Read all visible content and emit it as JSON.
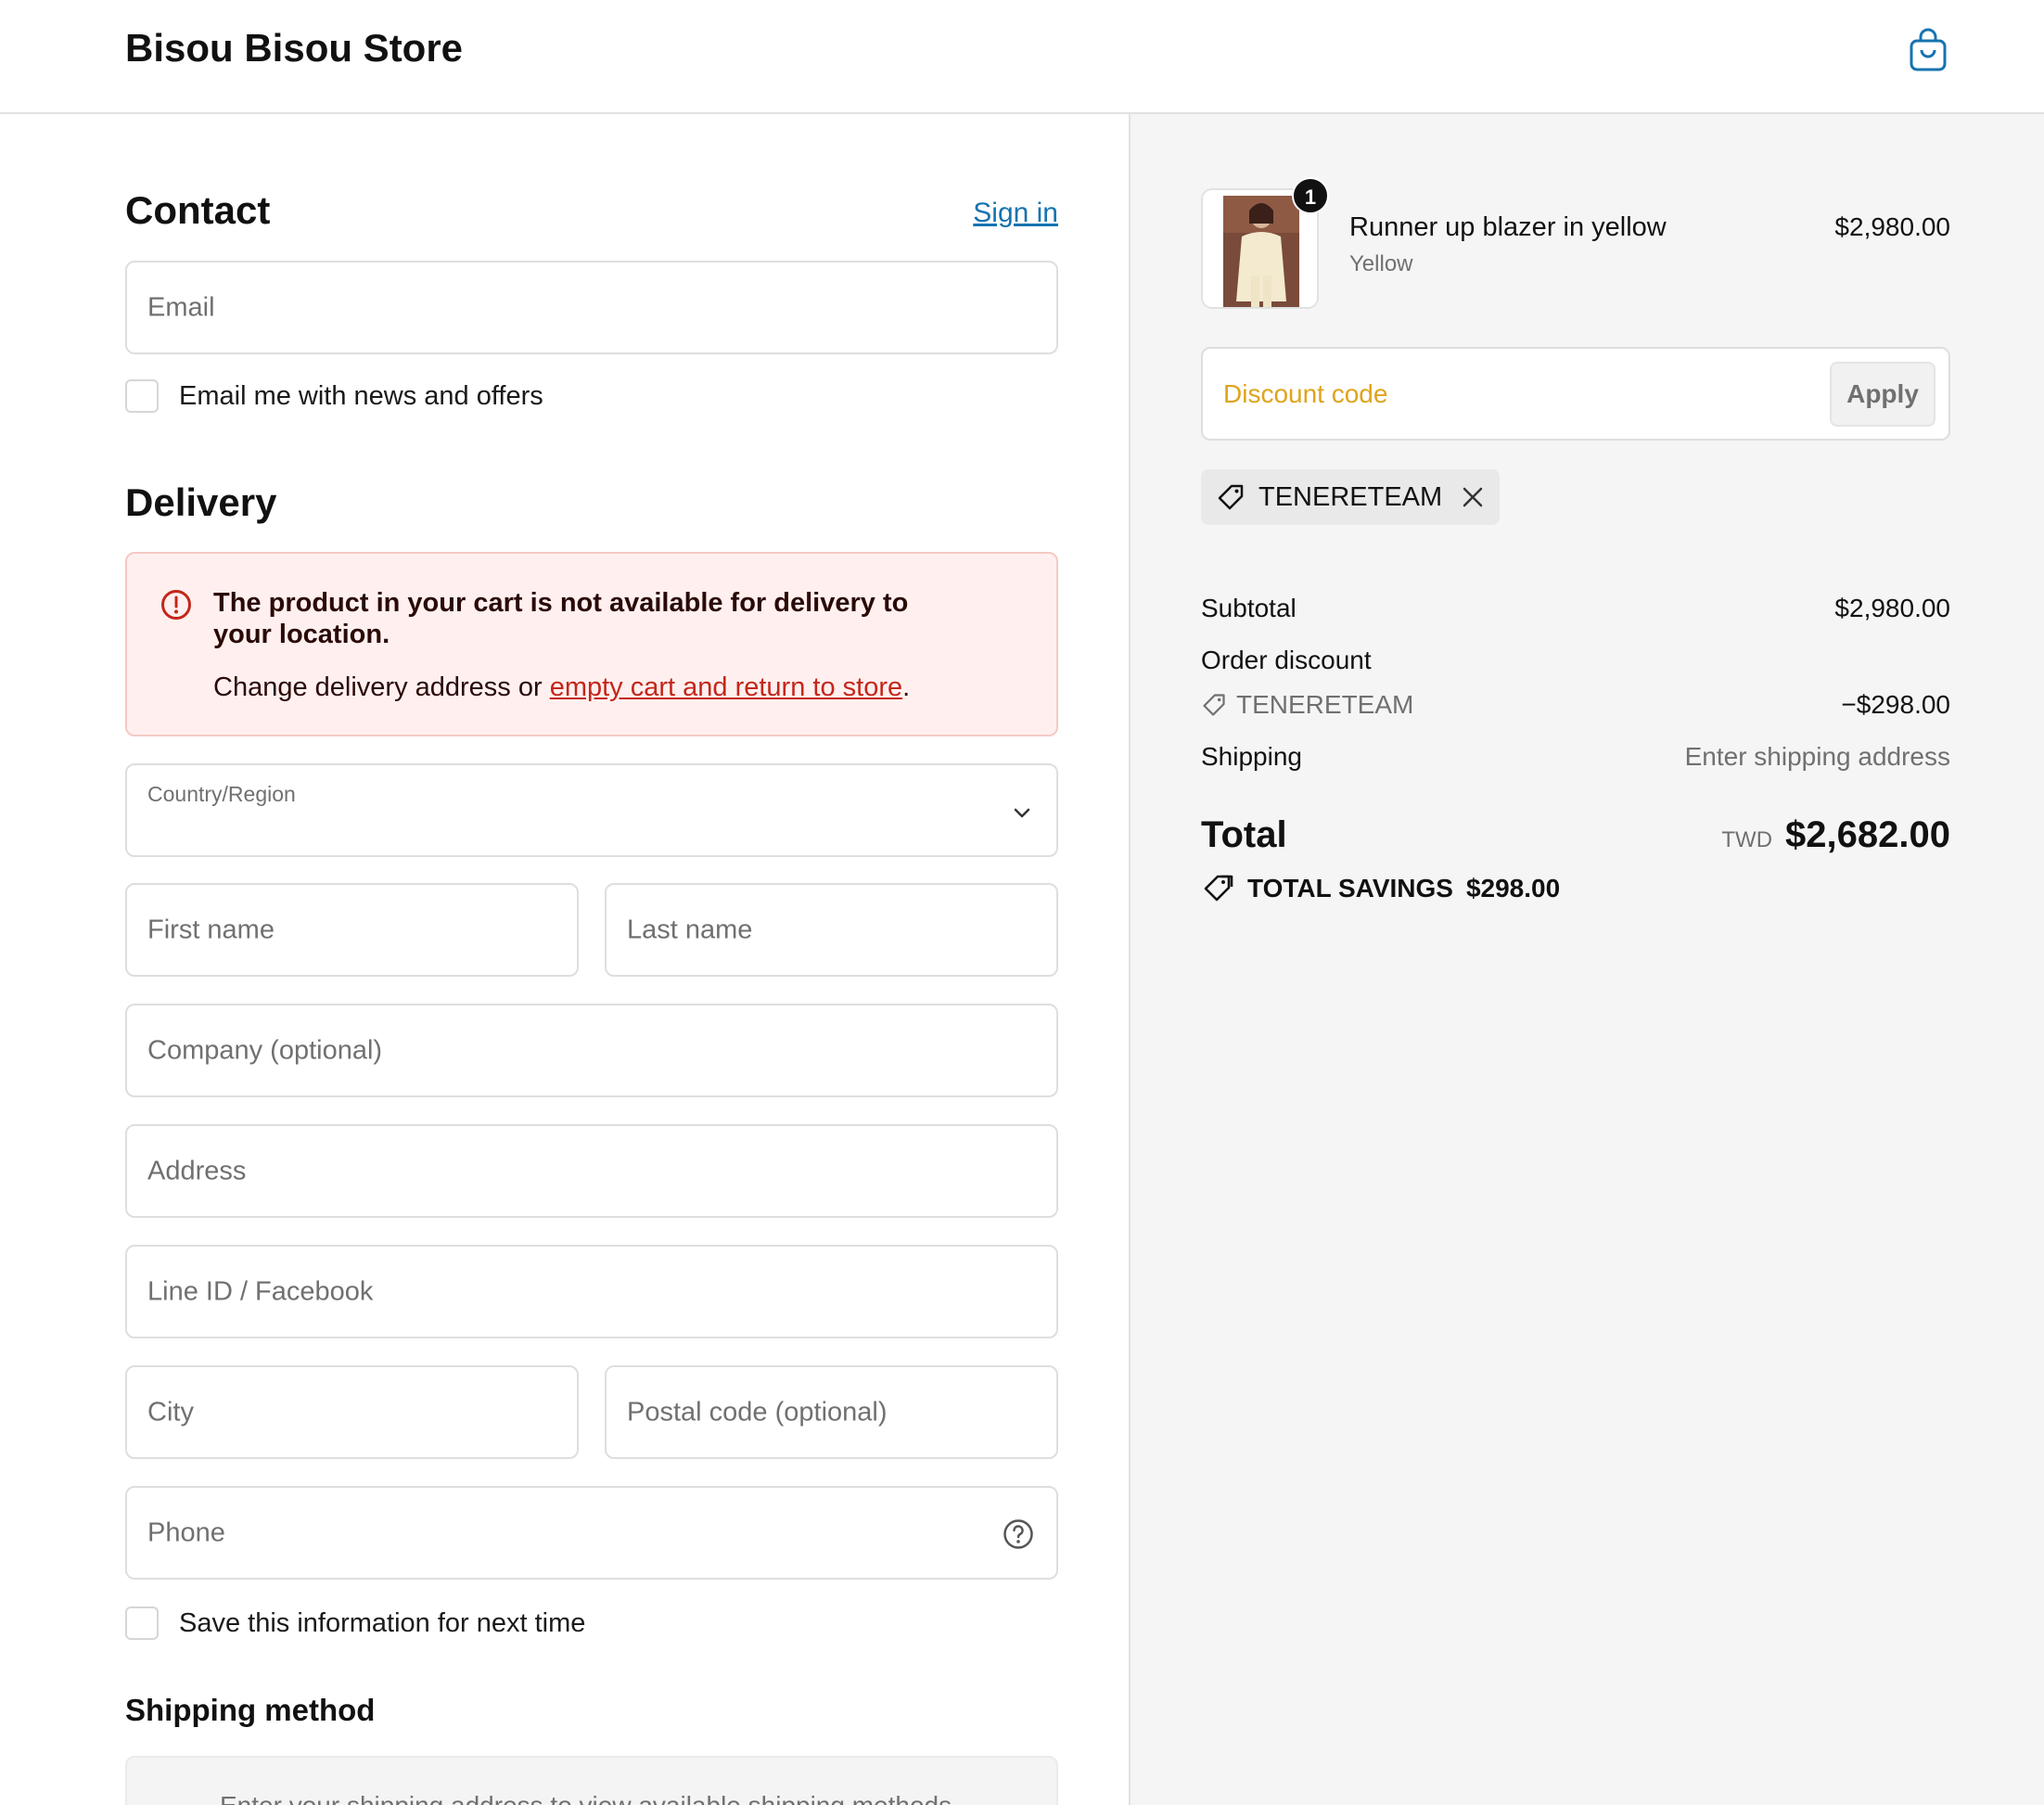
{
  "header": {
    "store_name": "Bisou Bisou Store",
    "cart_icon": "shopping-bag-icon"
  },
  "contact": {
    "title": "Contact",
    "signin_label": "Sign in",
    "email_placeholder": "Email",
    "newsletter_label": "Email me with news and offers"
  },
  "delivery": {
    "title": "Delivery",
    "alert": {
      "title": "The product in your cart is not available for delivery to your location.",
      "body_prefix": "Change delivery address or ",
      "link_text": "empty cart and return to store",
      "body_suffix": "."
    },
    "country_label": "Country/Region",
    "first_name": "First name",
    "last_name": "Last name",
    "company": "Company (optional)",
    "address": "Address",
    "line_id": "Line ID / Facebook",
    "city": "City",
    "postal_code": "Postal code (optional)",
    "phone": "Phone",
    "save_info_label": "Save this information for next time"
  },
  "shipping_method": {
    "title": "Shipping method",
    "message": "Enter your shipping address to view available shipping methods."
  },
  "summary": {
    "product": {
      "quantity": "1",
      "name": "Runner up blazer in yellow",
      "variant": "Yellow",
      "price": "$2,980.00"
    },
    "discount_placeholder": "Discount code",
    "apply_label": "Apply",
    "applied_code": "TENERETEAM",
    "subtotal_label": "Subtotal",
    "subtotal_value": "$2,980.00",
    "order_discount_label": "Order discount",
    "discount_code": "TENERETEAM",
    "discount_value": "−$298.00",
    "shipping_label": "Shipping",
    "shipping_value": "Enter shipping address",
    "total_label": "Total",
    "total_currency": "TWD",
    "total_value": "$2,682.00",
    "savings_label": "TOTAL SAVINGS",
    "savings_value": "$298.00"
  },
  "colors": {
    "link": "#1773b0",
    "alert_bg": "#fff0ef",
    "alert_link": "#c4261a",
    "discount_placeholder": "#e0a31c"
  }
}
